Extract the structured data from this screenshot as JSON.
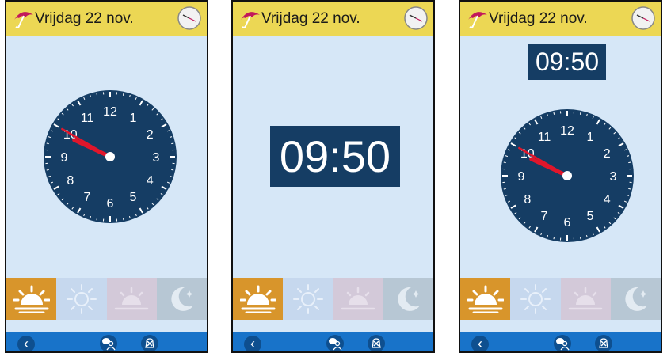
{
  "colors": {
    "topbar": "#ecd754",
    "screen_bg": "#d6e7f7",
    "clock_face": "#153d64",
    "hand": "#e0162b",
    "navbar": "#1873c9",
    "tile_morning": "#d8952b",
    "tile_day": "#c6d8ee",
    "tile_afternoon": "#d3c9d9",
    "tile_night": "#b7c7d4"
  },
  "screens": [
    {
      "header": {
        "date": "Vrijdag 22 nov.",
        "icon": "umbrella-icon",
        "clock_icon": "mini-clock-icon"
      },
      "view": "analog",
      "clock": {
        "numbers": [
          "12",
          "1",
          "2",
          "3",
          "4",
          "5",
          "6",
          "7",
          "8",
          "9",
          "10",
          "11"
        ],
        "hour": 9,
        "minute": 50
      },
      "tiles": [
        {
          "name": "morning",
          "icon": "sunrise-icon",
          "active": true
        },
        {
          "name": "day",
          "icon": "sun-icon",
          "active": false
        },
        {
          "name": "afternoon",
          "icon": "sunset-icon",
          "active": false
        },
        {
          "name": "night",
          "icon": "moon-icon",
          "active": false
        }
      ],
      "nav": {
        "back": "‹",
        "icons": [
          "speech-person-icon",
          "bell-off-icon"
        ]
      }
    },
    {
      "header": {
        "date": "Vrijdag 22 nov.",
        "icon": "umbrella-icon",
        "clock_icon": "mini-clock-icon"
      },
      "view": "digital",
      "digital_time": "09:50",
      "tiles": [
        {
          "name": "morning",
          "icon": "sunrise-icon",
          "active": true
        },
        {
          "name": "day",
          "icon": "sun-icon",
          "active": false
        },
        {
          "name": "afternoon",
          "icon": "sunset-icon",
          "active": false
        },
        {
          "name": "night",
          "icon": "moon-icon",
          "active": false
        }
      ],
      "nav": {
        "back": "‹",
        "icons": [
          "speech-person-icon",
          "bell-off-icon"
        ]
      }
    },
    {
      "header": {
        "date": "Vrijdag 22 nov.",
        "icon": "umbrella-icon",
        "clock_icon": "mini-clock-icon"
      },
      "view": "both",
      "digital_time": "09:50",
      "clock": {
        "numbers": [
          "12",
          "1",
          "2",
          "3",
          "4",
          "5",
          "6",
          "7",
          "8",
          "9",
          "10",
          "11"
        ],
        "hour": 9,
        "minute": 50
      },
      "tiles": [
        {
          "name": "morning",
          "icon": "sunrise-icon",
          "active": true
        },
        {
          "name": "day",
          "icon": "sun-icon",
          "active": false
        },
        {
          "name": "afternoon",
          "icon": "sunset-icon",
          "active": false
        },
        {
          "name": "night",
          "icon": "moon-icon",
          "active": false
        }
      ],
      "nav": {
        "back": "‹",
        "icons": [
          "speech-person-icon",
          "bell-off-icon"
        ]
      }
    }
  ]
}
